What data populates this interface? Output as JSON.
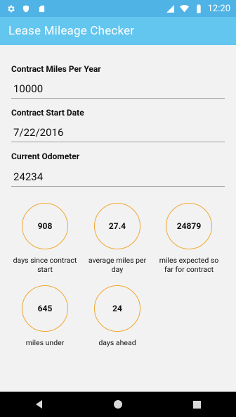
{
  "status_bar": {
    "time": "12:20",
    "icons": [
      "gear-icon",
      "shield-icon",
      "sd-card-icon",
      "cell-signal-icon",
      "wifi-icon",
      "battery-icon"
    ]
  },
  "app_bar": {
    "title": "Lease Mileage Checker"
  },
  "form": {
    "contract_miles": {
      "label": "Contract Miles Per Year",
      "value": "10000"
    },
    "start_date": {
      "label": "Contract Start Date",
      "value": "7/22/2016"
    },
    "odometer": {
      "label": "Current Odometer",
      "value": "24234"
    }
  },
  "stats": [
    {
      "value": "908",
      "label": "days since contract start"
    },
    {
      "value": "27.4",
      "label": "average miles per day"
    },
    {
      "value": "24879",
      "label": "miles expected so far for contract"
    },
    {
      "value": "645",
      "label": "miles under"
    },
    {
      "value": "24",
      "label": "days ahead"
    }
  ],
  "colors": {
    "status_bar": "#4fb3e6",
    "app_bar": "#63c6ef",
    "circle_border": "#f0a834"
  }
}
